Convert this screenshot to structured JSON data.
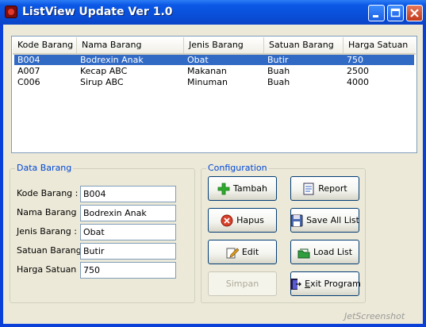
{
  "window": {
    "title": "ListView Update Ver 1.0"
  },
  "listview": {
    "columns": [
      "Kode Barang",
      "Nama Barang",
      "Jenis Barang",
      "Satuan Barang",
      "Harga Satuan"
    ],
    "rows": [
      [
        "B004",
        "Bodrexin Anak",
        "Obat",
        "Butir",
        "750"
      ],
      [
        "A007",
        "Kecap ABC",
        "Makanan",
        "Buah",
        "2500"
      ],
      [
        "C006",
        "Sirup ABC",
        "Minuman",
        "Buah",
        "4000"
      ]
    ],
    "selected_row": 0
  },
  "data_barang": {
    "title": "Data Barang",
    "kode_label": "Kode Barang :",
    "kode_value": "B004",
    "nama_label": "Nama Barang :",
    "nama_value": "Bodrexin Anak",
    "jenis_label": "Jenis Barang :",
    "jenis_value": "Obat",
    "satuan_label": "Satuan Barang :",
    "satuan_value": "Butir",
    "harga_label": "Harga Satuan :",
    "harga_value": "750"
  },
  "configuration": {
    "title": "Configuration",
    "tambah": "Tambah",
    "hapus": "Hapus",
    "edit": "Edit",
    "simpan": "Simpan",
    "report": "Report",
    "save_all": "Save All List",
    "load_list": "Load List",
    "exit_e": "E",
    "exit_rest": "xit Program"
  },
  "watermark": "JetScreenshot"
}
